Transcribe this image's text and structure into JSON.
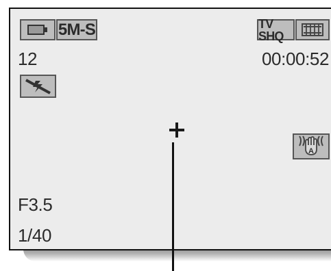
{
  "status": {
    "shot_count": "12",
    "recording_time": "00:00:52",
    "aperture": "F3.5",
    "shutter_speed": "1/40"
  },
  "badges": {
    "resolution": "5M-S",
    "quality": "TV SHQ"
  },
  "icons": {
    "battery": "battery-icon",
    "flash_off": "flash-off-icon",
    "film_strip": "film-strip-icon",
    "stabilizer_auto": "image-stabilizer-auto-icon",
    "center_focus": "center-focus-icon"
  }
}
